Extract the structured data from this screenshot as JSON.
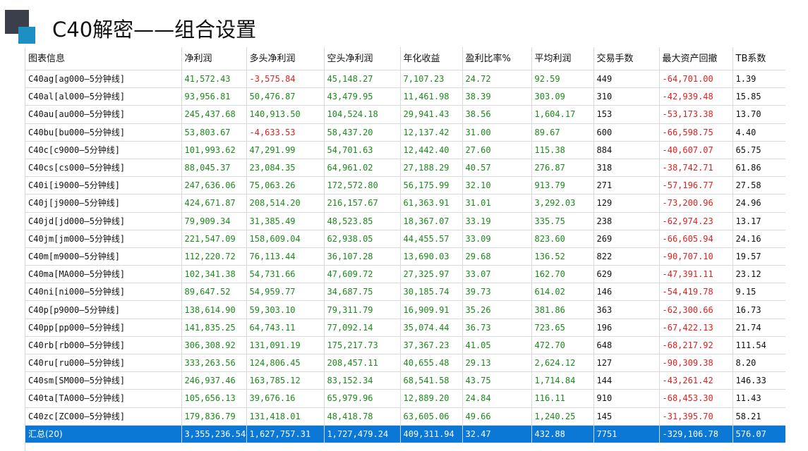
{
  "title": "C40解密——组合设置",
  "colors": {
    "positive": "#1a8a1a",
    "negative": "#e02020",
    "selected_row": "#0a78d4"
  },
  "columns": [
    "图表信息",
    "净利润",
    "多头净利润",
    "空头净利润",
    "年化收益",
    "盈利比率%",
    "平均利润",
    "交易手数",
    "最大资产回撤",
    "TB系数"
  ],
  "rows": [
    [
      "C40ag[ag000—5分钟线]",
      "41,572.43",
      "-3,575.84",
      "45,148.27",
      "7,107.23",
      "24.72",
      "92.59",
      "449",
      "-64,701.00",
      "1.39"
    ],
    [
      "C40al[al000—5分钟线]",
      "93,956.81",
      "50,476.87",
      "43,479.95",
      "11,461.98",
      "38.39",
      "303.09",
      "310",
      "-42,939.48",
      "15.85"
    ],
    [
      "C40au[au000—5分钟线]",
      "245,437.68",
      "140,913.50",
      "104,524.18",
      "29,941.43",
      "38.56",
      "1,604.17",
      "153",
      "-53,173.38",
      "13.70"
    ],
    [
      "C40bu[bu000—5分钟线]",
      "53,803.67",
      "-4,633.53",
      "58,437.20",
      "12,137.42",
      "31.00",
      "89.67",
      "600",
      "-66,598.75",
      "4.40"
    ],
    [
      "C40c[c9000—5分钟线]",
      "101,993.62",
      "47,291.99",
      "54,701.63",
      "12,442.40",
      "27.60",
      "115.38",
      "884",
      "-40,607.07",
      "65.75"
    ],
    [
      "C40cs[cs000—5分钟线]",
      "88,045.37",
      "23,084.35",
      "64,961.02",
      "27,188.29",
      "40.57",
      "276.87",
      "318",
      "-38,742.71",
      "61.86"
    ],
    [
      "C40i[i9000—5分钟线]",
      "247,636.06",
      "75,063.26",
      "172,572.80",
      "56,175.99",
      "32.10",
      "913.79",
      "271",
      "-57,196.77",
      "27.58"
    ],
    [
      "C40j[j9000—5分钟线]",
      "424,671.87",
      "208,514.20",
      "216,157.67",
      "61,363.91",
      "31.01",
      "3,292.03",
      "129",
      "-73,200.96",
      "24.96"
    ],
    [
      "C40jd[jd000—5分钟线]",
      "79,909.34",
      "31,385.49",
      "48,523.85",
      "18,367.07",
      "33.19",
      "335.75",
      "238",
      "-62,974.23",
      "13.17"
    ],
    [
      "C40jm[jm000—5分钟线]",
      "221,547.09",
      "158,609.04",
      "62,938.05",
      "44,455.57",
      "33.09",
      "823.60",
      "269",
      "-66,605.94",
      "24.16"
    ],
    [
      "C40m[m9000—5分钟线]",
      "112,220.72",
      "76,113.44",
      "36,107.28",
      "13,690.03",
      "29.68",
      "136.52",
      "822",
      "-90,707.10",
      "19.57"
    ],
    [
      "C40ma[MA000—5分钟线]",
      "102,341.38",
      "54,731.66",
      "47,609.72",
      "27,325.97",
      "33.07",
      "162.70",
      "629",
      "-47,391.11",
      "23.12"
    ],
    [
      "C40ni[ni000—5分钟线]",
      "89,647.52",
      "54,959.77",
      "34,687.75",
      "30,185.74",
      "39.73",
      "614.02",
      "146",
      "-54,419.78",
      "9.15"
    ],
    [
      "C40p[p9000—5分钟线]",
      "138,614.90",
      "59,303.10",
      "79,311.79",
      "16,909.91",
      "35.26",
      "381.86",
      "363",
      "-62,300.66",
      "16.73"
    ],
    [
      "C40pp[pp000—5分钟线]",
      "141,835.25",
      "64,743.11",
      "77,092.14",
      "35,074.44",
      "36.73",
      "723.65",
      "196",
      "-67,422.13",
      "21.74"
    ],
    [
      "C40rb[rb000—5分钟线]",
      "306,308.92",
      "131,091.19",
      "175,217.73",
      "37,367.23",
      "41.05",
      "472.70",
      "648",
      "-68,217.92",
      "111.54"
    ],
    [
      "C40ru[ru000—5分钟线]",
      "333,263.56",
      "124,806.45",
      "208,457.11",
      "40,655.48",
      "29.13",
      "2,624.12",
      "127",
      "-90,309.38",
      "8.20"
    ],
    [
      "C40sm[SM000—5分钟线]",
      "246,937.46",
      "163,785.12",
      "83,152.34",
      "68,541.58",
      "43.75",
      "1,714.84",
      "144",
      "-43,261.42",
      "146.33"
    ],
    [
      "C40ta[TA000—5分钟线]",
      "105,656.13",
      "39,676.16",
      "65,979.96",
      "12,889.20",
      "24.84",
      "116.11",
      "910",
      "-68,453.30",
      "11.43"
    ],
    [
      "C40zc[ZC000—5分钟线]",
      "179,836.79",
      "131,418.01",
      "48,418.78",
      "63,605.06",
      "49.66",
      "1,240.25",
      "145",
      "-31,395.70",
      "58.21"
    ]
  ],
  "total": [
    "汇总(20)",
    "3,355,236.54",
    "1,627,757.31",
    "1,727,479.24",
    "409,311.94",
    "32.47",
    "432.88",
    "7751",
    "-329,106.78",
    "576.07"
  ]
}
